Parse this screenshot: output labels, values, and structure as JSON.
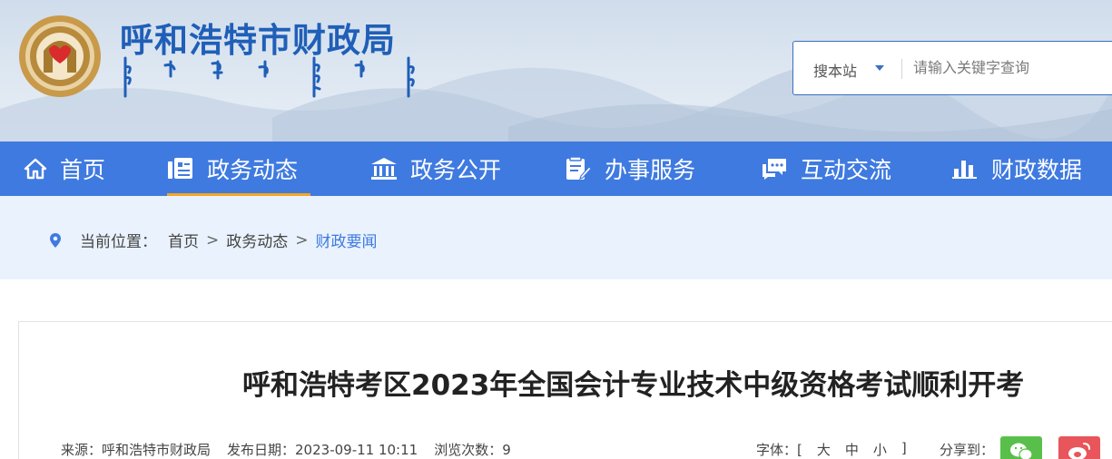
{
  "header": {
    "site_title": "呼和浩特市财政局",
    "search": {
      "scope_label": "搜本站",
      "placeholder": "请输入关键字查询"
    }
  },
  "nav": {
    "items": [
      {
        "label": "首页",
        "icon": "home-icon"
      },
      {
        "label": "政务动态",
        "icon": "news-icon",
        "active": true
      },
      {
        "label": "政务公开",
        "icon": "bank-icon"
      },
      {
        "label": "办事服务",
        "icon": "form-icon"
      },
      {
        "label": "互动交流",
        "icon": "chat-icon"
      },
      {
        "label": "财政数据",
        "icon": "bar-chart-icon"
      }
    ]
  },
  "breadcrumb": {
    "prefix": "当前位置：",
    "items": [
      "首页",
      "政务动态",
      "财政要闻"
    ],
    "separator": ">"
  },
  "article": {
    "title": "呼和浩特考区2023年全国会计专业技术中级资格考试顺利开考",
    "source": "来源：呼和浩特市财政局",
    "publish_date": "发布日期：2023-09-11 10:11",
    "views": "浏览次数：9",
    "font_label": "字体：[",
    "font_large": "大",
    "font_medium": "中",
    "font_small": "小",
    "font_close": "]",
    "share_label": "分享到："
  },
  "colors": {
    "nav_bg": "#3f7ae0",
    "nav_active_underline": "#f5a623",
    "title_blue": "#1f5fb8",
    "breadcrumb_bg": "#e9f2fd",
    "wechat": "#58c04a",
    "weibo": "#e8555a"
  }
}
